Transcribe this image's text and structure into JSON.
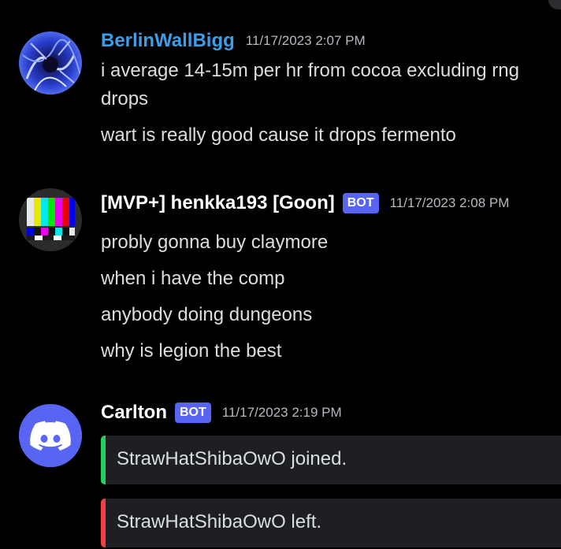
{
  "messages": [
    {
      "username": "BerlinWallBigg",
      "timestamp": "11/17/2023 2:07 PM",
      "lines": [
        "i average 14-15m per hr from cocoa excluding rng",
        "drops",
        "wart is really good cause it drops fermento"
      ]
    },
    {
      "username": "[MVP+] henkka193 [Goon]",
      "badge": "BOT",
      "timestamp": "11/17/2023 2:08 PM",
      "lines": [
        "probly gonna buy claymore",
        "when i have the comp",
        "anybody doing dungeons",
        "why is legion the best"
      ]
    },
    {
      "username": "Carlton",
      "badge": "BOT",
      "timestamp": "11/17/2023 2:19 PM",
      "embeds": [
        {
          "text": "StrawHatShibaOwO joined.",
          "color": "#23d160"
        },
        {
          "text": "StrawHatShibaOwO left.",
          "color": "#f23f42"
        }
      ]
    }
  ],
  "colors": {
    "background": "#000000",
    "username_link": "#3d9ee8",
    "bot_badge": "#5865f2",
    "embed_bg": "#1e1f22"
  }
}
